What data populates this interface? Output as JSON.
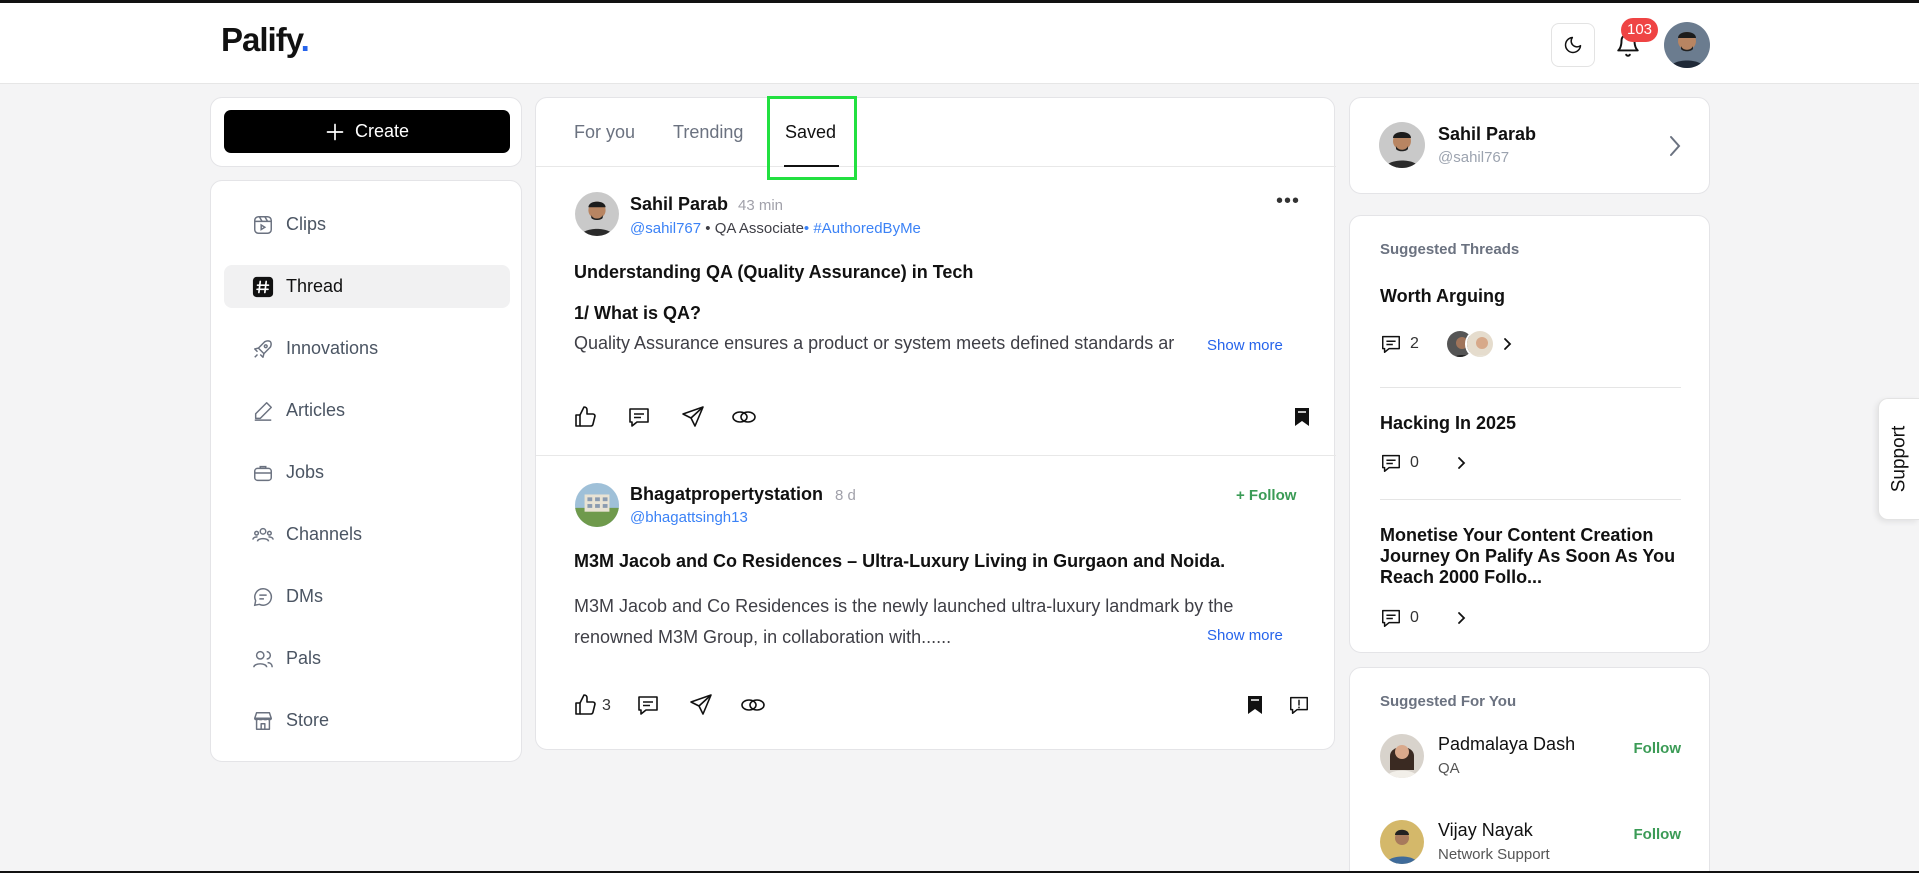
{
  "header": {
    "logo": "Palify",
    "logo_dot": ".",
    "notification_count": "103"
  },
  "create": {
    "label": "Create"
  },
  "nav": [
    {
      "label": "Clips",
      "icon": "clips-icon"
    },
    {
      "label": "Thread",
      "icon": "hash-icon"
    },
    {
      "label": "Innovations",
      "icon": "rocket-icon"
    },
    {
      "label": "Articles",
      "icon": "pencil-icon"
    },
    {
      "label": "Jobs",
      "icon": "briefcase-icon"
    },
    {
      "label": "Channels",
      "icon": "group-icon"
    },
    {
      "label": "DMs",
      "icon": "chat-icon"
    },
    {
      "label": "Pals",
      "icon": "users-icon"
    },
    {
      "label": "Store",
      "icon": "store-icon"
    }
  ],
  "tabs": [
    "For you",
    "Trending",
    "Saved"
  ],
  "posts": [
    {
      "author": "Sahil Parab",
      "time": "43 min",
      "handle": "@sahil767",
      "role": " • QA Associate",
      "tag": "• #AuthoredByMe",
      "title": "Understanding QA (Quality Assurance) in Tech",
      "subtitle": "1/ What is QA?",
      "body": "Quality Assurance ensures a product or system meets defined standards ar",
      "show_more": "Show more"
    },
    {
      "author": "Bhagatpropertystation",
      "time": "8 d",
      "handle": "@bhagattsingh13",
      "follow": "+ Follow",
      "title": "M3M Jacob and Co Residences –  Ultra-Luxury Living in Gurgaon and Noida.",
      "body": "M3M Jacob and Co Residences is the newly launched ultra-luxury landmark by the renowned M3M Group, in collaboration with......",
      "show_more": "Show more",
      "likes": "3"
    }
  ],
  "profile": {
    "name": "Sahil Parab",
    "handle": "@sahil767"
  },
  "suggested_threads": {
    "title": "Suggested Threads",
    "items": [
      {
        "title": "Worth Arguing",
        "comments": "2"
      },
      {
        "title": "Hacking In 2025",
        "comments": "0"
      },
      {
        "title": "Monetise Your Content Creation Journey On Palify As Soon As You Reach 2000 Follo...",
        "comments": "0"
      }
    ]
  },
  "suggested_for_you": {
    "title": "Suggested For You",
    "people": [
      {
        "name": "Padmalaya Dash",
        "role": "QA",
        "action": "Follow"
      },
      {
        "name": "Vijay Nayak",
        "role": "Network Support",
        "action": "Follow"
      }
    ]
  },
  "support": {
    "label": "Support"
  },
  "colors": {
    "accent": "#2563eb",
    "follow": "#3b9b56",
    "badge": "#ef4444",
    "highlight": "#22e040"
  }
}
